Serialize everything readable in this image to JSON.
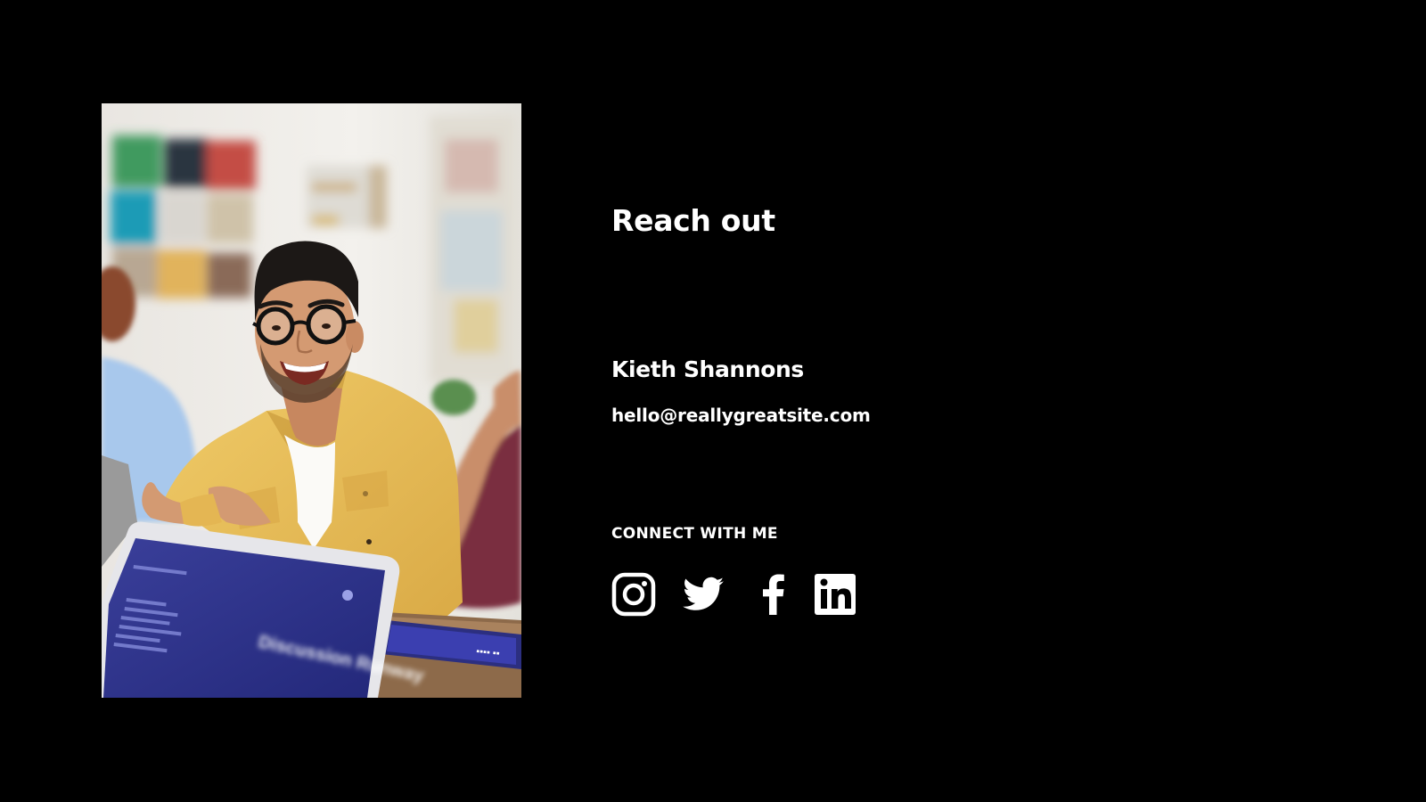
{
  "slide": {
    "heading": "Reach out",
    "name": "Kieth Shannons",
    "email": "hello@reallygreatsite.com",
    "connect_label": "CONNECT WITH ME"
  },
  "photo": {
    "subject": "smiling-man-with-glasses-in-yellow-jacket",
    "laptop_text": "Discussion Runway"
  },
  "social": [
    {
      "name": "instagram",
      "icon": "instagram-icon"
    },
    {
      "name": "twitter",
      "icon": "twitter-icon"
    },
    {
      "name": "facebook",
      "icon": "facebook-icon"
    },
    {
      "name": "linkedin",
      "icon": "linkedin-icon"
    }
  ],
  "colors": {
    "background": "#000000",
    "text": "#ffffff",
    "jacket": "#e7be55",
    "laptop_screen": "#2a2f86"
  }
}
